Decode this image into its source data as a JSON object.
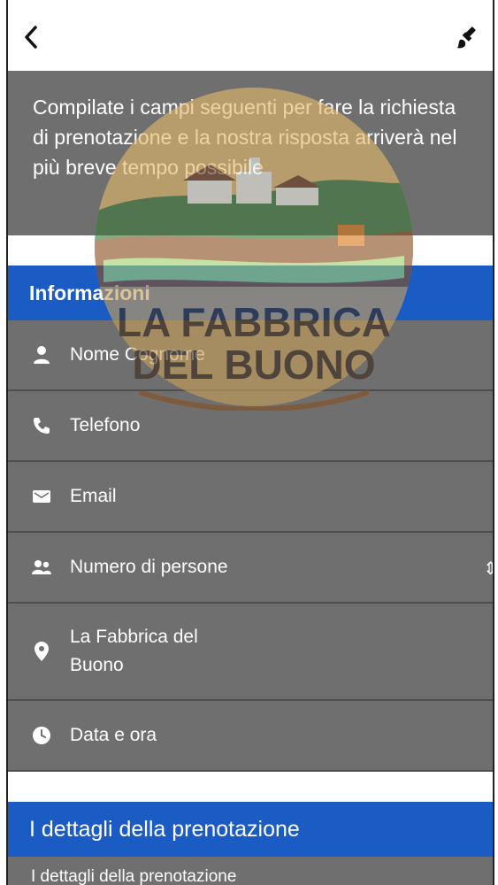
{
  "intro": {
    "text": "Compilate i campi seguenti per fare la richiesta di prenotazione e la nostra risposta arriverà nel più breve tempo possibile"
  },
  "logo": {
    "line1": "LA FABBRICA",
    "line2": "DEL BUONO"
  },
  "sections": {
    "info_title": "Informazioni",
    "details_title": "I dettagli della prenotazione"
  },
  "fields": {
    "name": "Nome Cognome",
    "phone": "Telefono",
    "email": "Email",
    "people": "Numero di persone",
    "location": "La Fabbrica del\nBuono",
    "datetime": "Data e ora",
    "details_placeholder": "I dettagli della prenotazione"
  },
  "icons": {
    "back": "chevron-left-icon",
    "brush": "brush-icon",
    "person": "person-icon",
    "phone": "phone-icon",
    "email": "email-icon",
    "group": "group-icon",
    "location": "location-pin-icon",
    "clock": "clock-icon"
  },
  "colors": {
    "accent": "#1a5bc4",
    "field_bg": "#6f6f6f",
    "divider": "#4e4e4e"
  }
}
